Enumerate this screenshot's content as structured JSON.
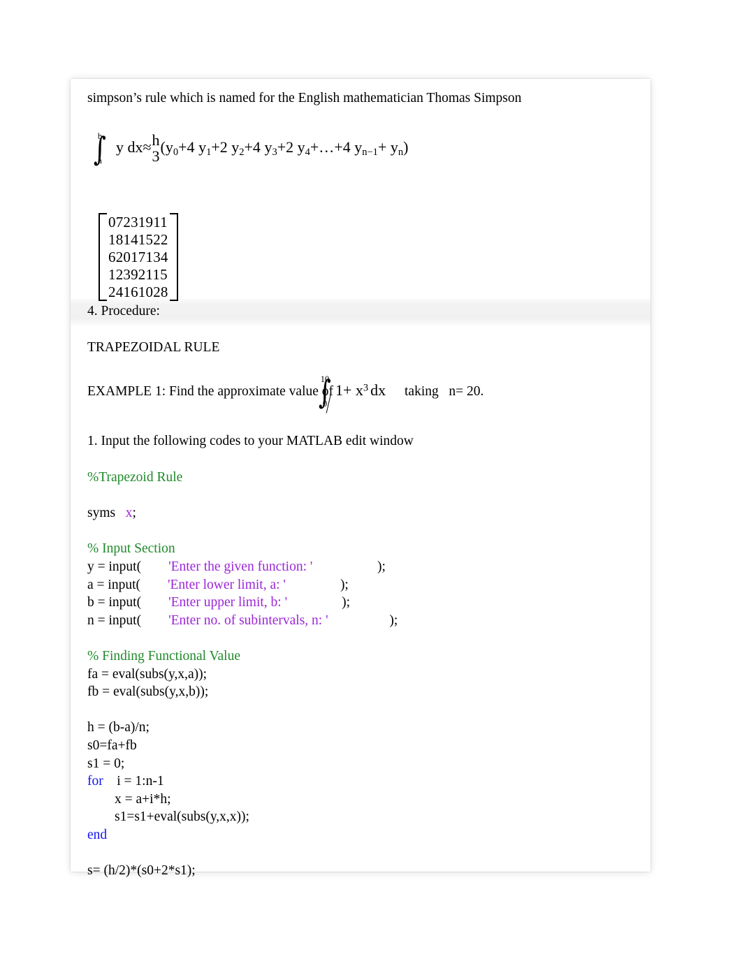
{
  "document": {
    "intro_line": "simpson’s rule which is named for the English mathematician Thomas Simpson",
    "simpson_formula": {
      "integral_upper": "b",
      "integral_lower": "a",
      "integrand": "y dx",
      "approx_symbol": "≈",
      "fraction_numerator": "h",
      "fraction_denominator": "3",
      "open_paren": "(",
      "terms": [
        {
          "coef": "",
          "base": "y",
          "sub": "0"
        },
        {
          "coef": "+4",
          "base": "y",
          "sub": "1"
        },
        {
          "coef": "+2",
          "base": "y",
          "sub": "2"
        },
        {
          "coef": "+4",
          "base": "y",
          "sub": "3"
        },
        {
          "coef": "+2",
          "base": "y",
          "sub": "4"
        }
      ],
      "ellipsis": "+…",
      "tail_terms": [
        {
          "coef": "+4",
          "base": "y",
          "sub": "n−1"
        },
        {
          "coef": "+",
          "base": "y",
          "sub": "n"
        }
      ],
      "close_paren": ")"
    },
    "matrix": {
      "rows": [
        "07231911",
        "18141522",
        "62017134",
        "12392115",
        "24161028"
      ]
    },
    "section_heading": "4. Procedure:",
    "rule_title": "TRAPEZOIDAL RULE",
    "example": {
      "lead_text": "EXAMPLE 1: Find the approximate value of",
      "integral_upper": "10",
      "integral_lower": "0",
      "integrand_prefix": "1+ x",
      "integrand_exponent": "3",
      "integrand_suffix": "dx",
      "trailing_text": "taking   n= 20."
    },
    "instruction": "1. Input the following codes to your MATLAB edit window",
    "code_lines": [
      {
        "segments": [
          {
            "text": "%Trapezoid Rule",
            "style": "green"
          }
        ]
      },
      {
        "segments": [
          {
            "text": "",
            "style": "plain"
          }
        ]
      },
      {
        "segments": [
          {
            "text": "syms   ",
            "style": "plain"
          },
          {
            "text": "x",
            "style": "purple"
          },
          {
            "text": ";",
            "style": "plain"
          }
        ]
      },
      {
        "segments": [
          {
            "text": "",
            "style": "plain"
          }
        ]
      },
      {
        "segments": [
          {
            "text": "% Input Section",
            "style": "green"
          }
        ]
      },
      {
        "segments": [
          {
            "text": "y = input(        ",
            "style": "plain"
          },
          {
            "text": "'Enter the given function: '",
            "style": "purple"
          },
          {
            "text": "                   );",
            "style": "plain"
          }
        ]
      },
      {
        "segments": [
          {
            "text": "a = input(        ",
            "style": "plain"
          },
          {
            "text": "'Enter lower limit, a: '",
            "style": "purple"
          },
          {
            "text": "                );",
            "style": "plain"
          }
        ]
      },
      {
        "segments": [
          {
            "text": "b = input(        ",
            "style": "plain"
          },
          {
            "text": "'Enter upper limit, b: '",
            "style": "purple"
          },
          {
            "text": "                );",
            "style": "plain"
          }
        ]
      },
      {
        "segments": [
          {
            "text": "n = input(        ",
            "style": "plain"
          },
          {
            "text": "'Enter no. of subintervals, n: '",
            "style": "purple"
          },
          {
            "text": "                  );",
            "style": "plain"
          }
        ]
      },
      {
        "segments": [
          {
            "text": "",
            "style": "plain"
          }
        ]
      },
      {
        "segments": [
          {
            "text": "% Finding Functional Value",
            "style": "green"
          }
        ]
      },
      {
        "segments": [
          {
            "text": "fa = eval(subs(y,x,a));",
            "style": "plain"
          }
        ]
      },
      {
        "segments": [
          {
            "text": "fb = eval(subs(y,x,b));",
            "style": "plain"
          }
        ]
      },
      {
        "segments": [
          {
            "text": "",
            "style": "plain"
          }
        ]
      },
      {
        "segments": [
          {
            "text": "h = (b-a)/n;",
            "style": "plain"
          }
        ]
      },
      {
        "segments": [
          {
            "text": "s0=fa+fb",
            "style": "plain"
          }
        ]
      },
      {
        "segments": [
          {
            "text": "s1 = 0;",
            "style": "plain"
          }
        ]
      },
      {
        "segments": [
          {
            "text": "for",
            "style": "blue"
          },
          {
            "text": "    i = 1:n-1",
            "style": "plain"
          }
        ]
      },
      {
        "segments": [
          {
            "text": "        x = a+i*h;",
            "style": "plain"
          }
        ]
      },
      {
        "segments": [
          {
            "text": "        s1=s1+eval(subs(y,x,x));",
            "style": "plain"
          }
        ]
      },
      {
        "segments": [
          {
            "text": "end",
            "style": "blue"
          }
        ]
      },
      {
        "segments": [
          {
            "text": "",
            "style": "plain"
          }
        ]
      },
      {
        "segments": [
          {
            "text": "s= (h/2)*(s0+2*s1);",
            "style": "plain"
          }
        ]
      }
    ],
    "colors": {
      "comment_green": "#1f8a2a",
      "string_purple": "#9b26d6",
      "keyword_blue": "#1414ef",
      "text_black": "#000000",
      "page_background": "#ffffff"
    }
  }
}
